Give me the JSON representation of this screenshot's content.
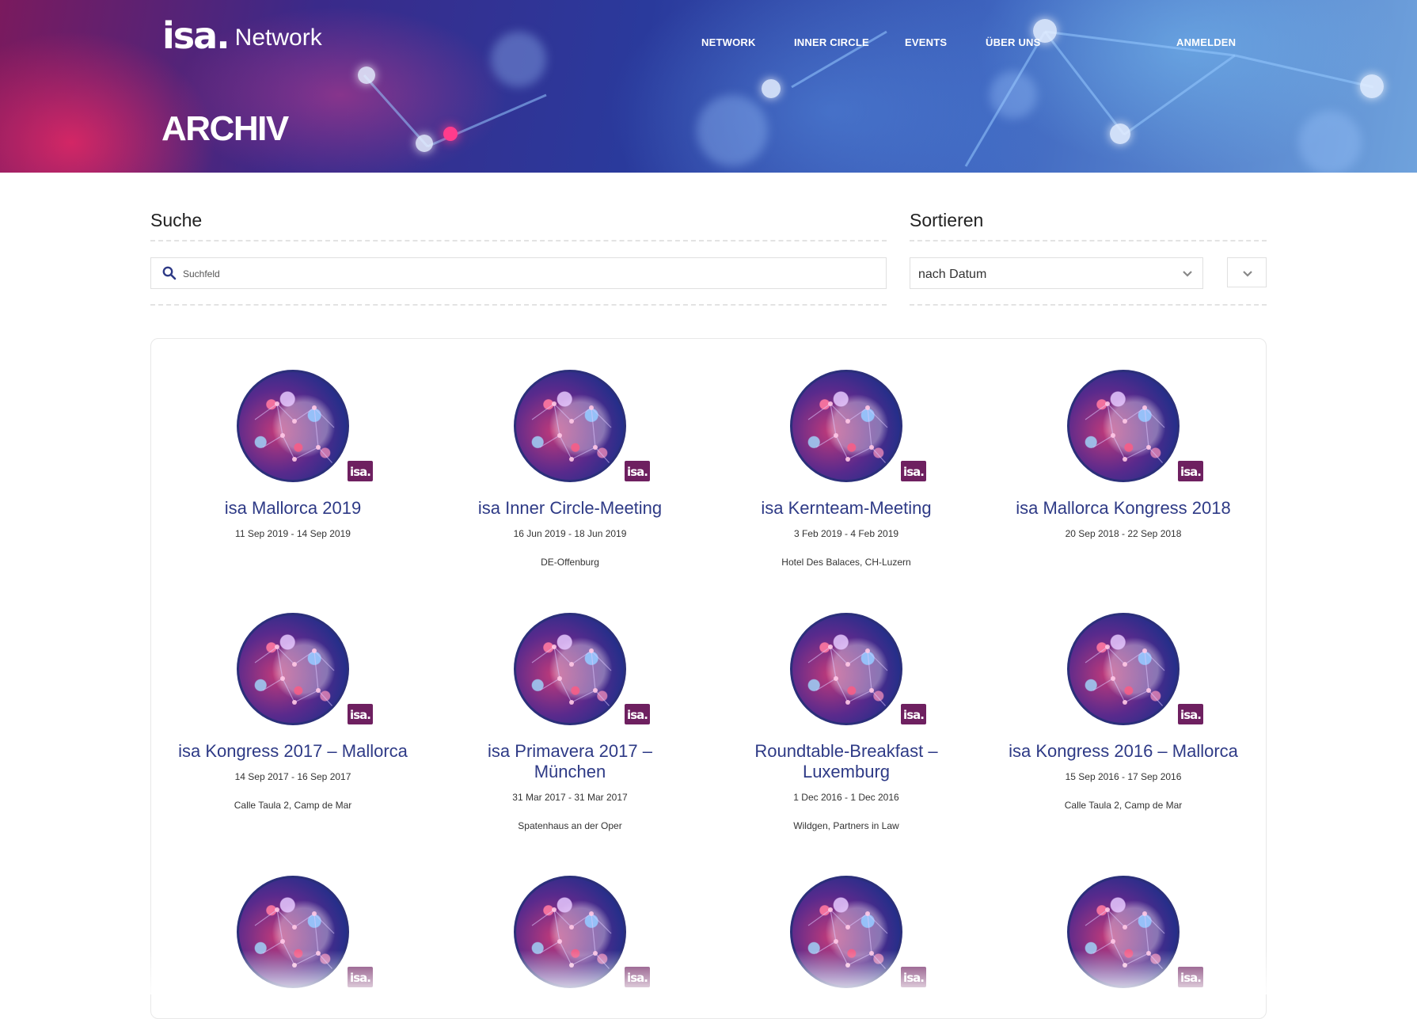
{
  "header": {
    "logo_mark": "isa.",
    "logo_word": "Network",
    "nav": [
      {
        "label": "NETWORK"
      },
      {
        "label": "INNER CIRCLE"
      },
      {
        "label": "EVENTS"
      },
      {
        "label": "ÜBER UNS"
      },
      {
        "label": "ANMELDEN"
      }
    ],
    "page_title": "ARCHIV"
  },
  "search": {
    "title": "Suche",
    "placeholder": "Suchfeld",
    "icon": "search-icon"
  },
  "sort": {
    "title": "Sortieren",
    "selected": "nach Datum",
    "icon": "chevron-down-icon"
  },
  "colors": {
    "title_blue": "#2e3a86",
    "badge_purple": "#6e2060",
    "avatar_border": "#2b2f7a"
  },
  "events": [
    {
      "title": "isa Mallorca 2019",
      "date": "11 Sep 2019 - 14 Sep 2019",
      "place": "",
      "badge": "isa."
    },
    {
      "title": "isa Inner Circle-Meeting",
      "date": "16 Jun 2019 - 18 Jun 2019",
      "place": "DE-Offenburg",
      "badge": "isa."
    },
    {
      "title": "isa Kernteam-Meeting",
      "date": "3 Feb 2019 - 4 Feb 2019",
      "place": "Hotel Des Balaces, CH-Luzern",
      "badge": "isa."
    },
    {
      "title": "isa Mallorca Kongress 2018",
      "date": "20 Sep 2018 - 22 Sep 2018",
      "place": "",
      "badge": "isa."
    },
    {
      "title": "isa Kongress 2017 – Mallorca",
      "date": "14 Sep 2017 - 16 Sep 2017",
      "place": "Calle Taula 2, Camp de Mar",
      "badge": "isa."
    },
    {
      "title": "isa Primavera 2017 – München",
      "date": "31 Mar 2017 - 31 Mar 2017",
      "place": "Spatenhaus an der Oper",
      "badge": "isa."
    },
    {
      "title": "Roundtable-Breakfast – Luxemburg",
      "date": "1 Dec 2016 - 1 Dec 2016",
      "place": "Wildgen, Partners in Law",
      "badge": "isa."
    },
    {
      "title": "isa Kongress 2016 – Mallorca",
      "date": "15 Sep 2016 - 17 Sep 2016",
      "place": "Calle Taula 2, Camp de Mar",
      "badge": "isa."
    },
    {
      "title": "",
      "date": "",
      "place": "",
      "badge": "isa."
    },
    {
      "title": "",
      "date": "",
      "place": "",
      "badge": "isa."
    },
    {
      "title": "",
      "date": "",
      "place": "",
      "badge": "isa."
    },
    {
      "title": "",
      "date": "",
      "place": "",
      "badge": "isa."
    }
  ]
}
